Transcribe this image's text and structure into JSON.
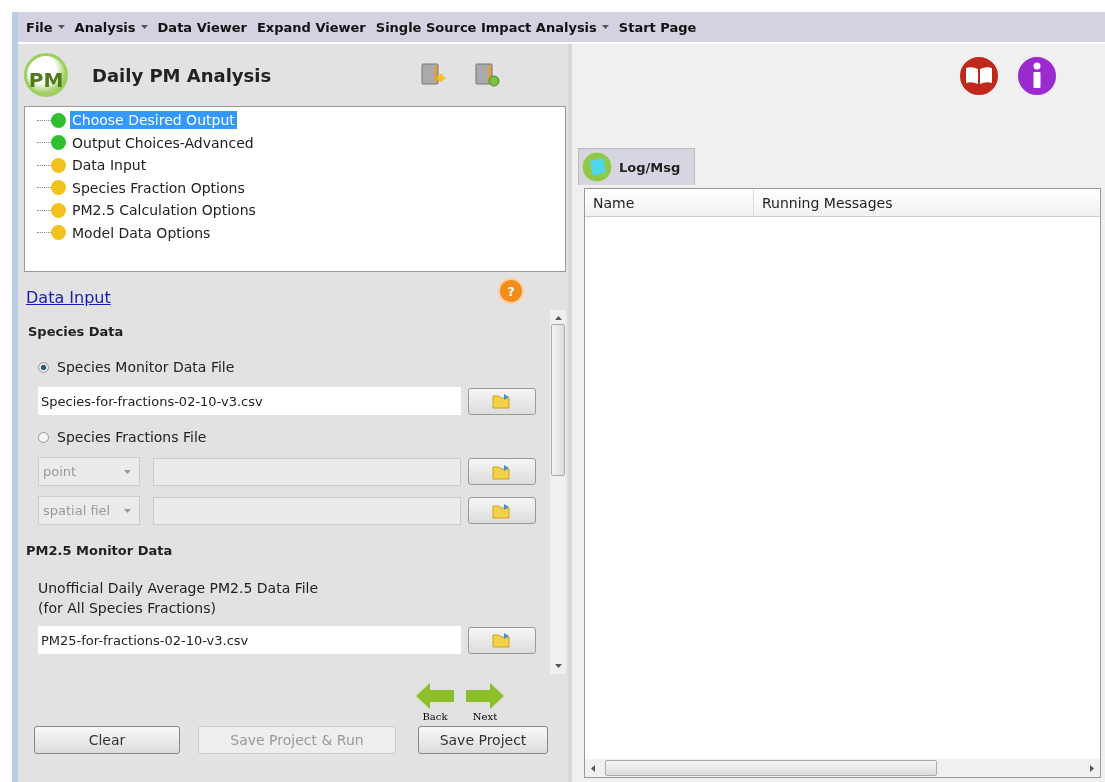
{
  "menu": [
    {
      "label": "File",
      "dropdown": true
    },
    {
      "label": "Analysis",
      "dropdown": true
    },
    {
      "label": "Data Viewer",
      "dropdown": false
    },
    {
      "label": "Expand Viewer",
      "dropdown": false
    },
    {
      "label": "Single Source Impact Analysis",
      "dropdown": true
    },
    {
      "label": "Start Page",
      "dropdown": false
    }
  ],
  "panel": {
    "logo_text": "PM",
    "title": "Daily PM Analysis"
  },
  "tree": [
    {
      "label": "Choose Desired Output",
      "color": "#2fc02f",
      "selected": true
    },
    {
      "label": "Output Choices-Advanced",
      "color": "#2fc02f",
      "selected": false
    },
    {
      "label": "Data Input",
      "color": "#f2c21c",
      "selected": false
    },
    {
      "label": "Species Fraction Options",
      "color": "#f2c21c",
      "selected": false
    },
    {
      "label": "PM2.5 Calculation Options",
      "color": "#f2c21c",
      "selected": false
    },
    {
      "label": "Model Data Options",
      "color": "#f2c21c",
      "selected": false
    }
  ],
  "section": {
    "title": "Data Input",
    "help_glyph": "?"
  },
  "species_data": {
    "heading": "Species Data",
    "options": [
      {
        "label": "Species Monitor Data File",
        "selected": true,
        "file": "Species-for-fractions-02-10-v3.csv"
      },
      {
        "label": "Species Fractions File",
        "selected": false
      }
    ],
    "fraction_rows": [
      {
        "select": "point",
        "disabled": true
      },
      {
        "select": "spatial fiel",
        "disabled": true
      }
    ]
  },
  "pm25": {
    "heading": "PM2.5 Monitor Data",
    "label": "Unofficial Daily Average PM2.5 Data File\n(for All Species Fractions)",
    "file": "PM25-for-fractions-02-10-v3.csv"
  },
  "nav": {
    "back": "Back",
    "next": "Next"
  },
  "buttons": [
    {
      "label": "Clear",
      "disabled": false
    },
    {
      "label": "Save Project & Run",
      "disabled": true
    },
    {
      "label": "Save Project",
      "disabled": false
    }
  ],
  "tabs": [
    {
      "label": "Log/Msg",
      "selected": true
    }
  ],
  "columns": [
    "Name",
    "Running Messages"
  ]
}
